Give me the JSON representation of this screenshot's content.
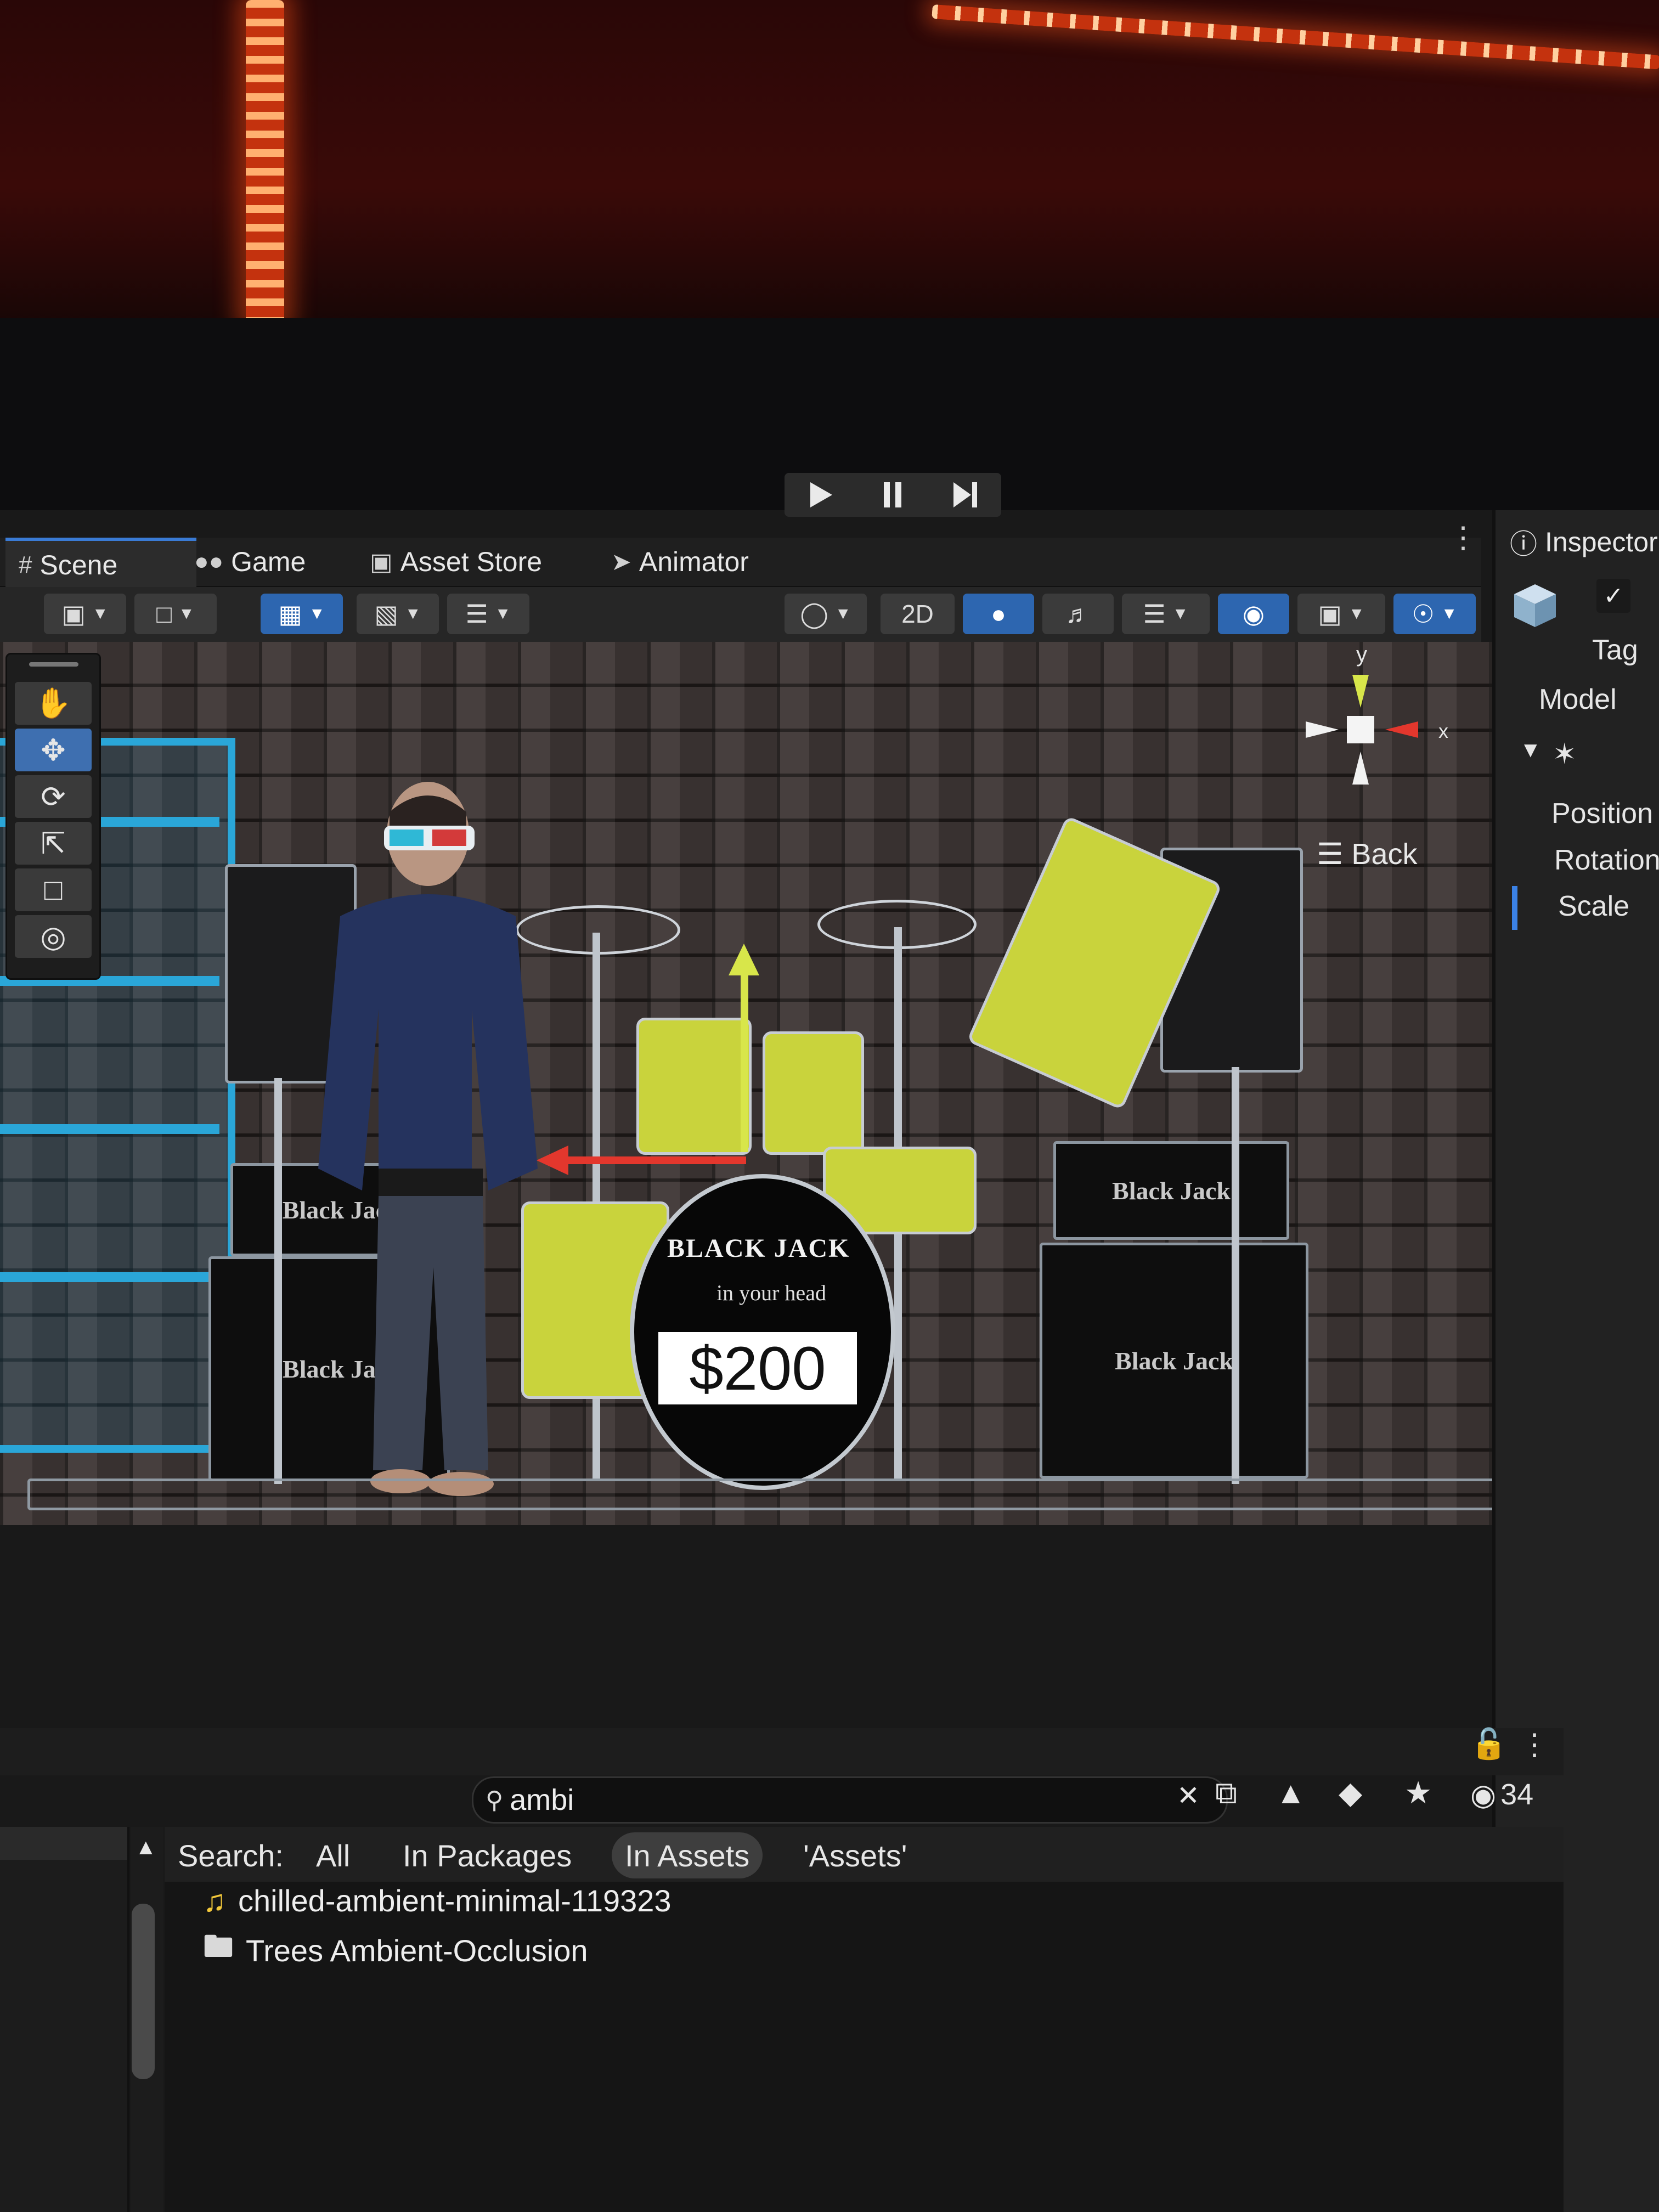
{
  "play_controls": {
    "play_icon": "play-icon",
    "pause_icon": "pause-icon",
    "step_icon": "step-icon"
  },
  "tabs": [
    {
      "label": "Scene",
      "icon": "scene-grid-icon"
    },
    {
      "label": "Game",
      "icon": "gamepad-icon"
    },
    {
      "label": "Asset Store",
      "icon": "bag-icon"
    },
    {
      "label": "Animator",
      "icon": "animator-icon"
    }
  ],
  "toolbar": {
    "view_2d_label": "2D"
  },
  "viewport": {
    "gizmo": {
      "y_label": "y",
      "x_label": "x"
    },
    "view_label": "Back",
    "price_tag": "$200",
    "kick_brand": "BLACK JACK",
    "kick_sub": "in your head",
    "amp_left_top": "Black Jac",
    "amp_left_bottom": "Black Ja",
    "amp_right_top": "Black Jack",
    "amp_right_bottom": "Black Jack"
  },
  "inspector": {
    "title": "Inspector",
    "tag_label": "Tag",
    "model_label": "Model",
    "position_label": "Position",
    "rotation_label": "Rotation",
    "scale_label": "Scale"
  },
  "project": {
    "search_value": "ambi",
    "hidden_count": "34",
    "search_label": "Search:",
    "filters": [
      {
        "label": "All",
        "active": false
      },
      {
        "label": "In Packages",
        "active": false
      },
      {
        "label": "In Assets",
        "active": true
      },
      {
        "label": "'Assets'",
        "active": false
      }
    ],
    "results": [
      {
        "name": "chilled-ambient-minimal-119323",
        "icon": "audio-clip-icon"
      },
      {
        "name": "Trees Ambient-Occlusion",
        "icon": "folder-icon"
      }
    ]
  },
  "colors": {
    "accent": "#3a7bd5",
    "gizmo_y": "#d8e64a",
    "gizmo_x": "#e3372d",
    "scaffold": "#2aa6d8",
    "drum_shell": "#c9d33c"
  }
}
